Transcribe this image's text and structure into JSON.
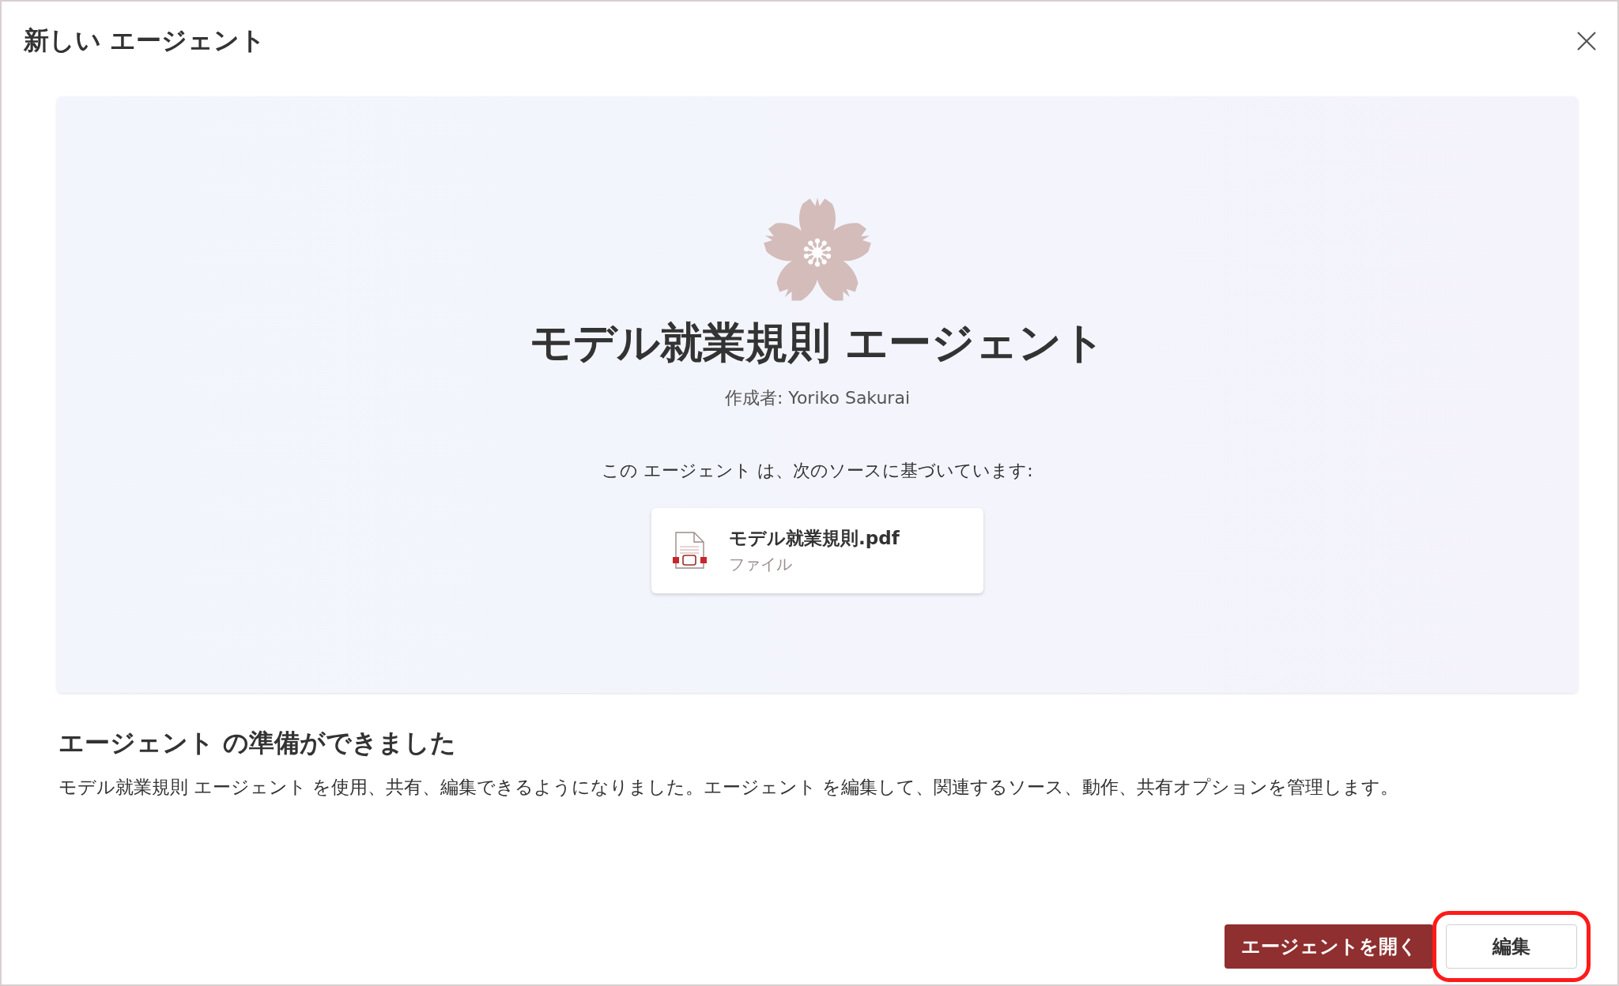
{
  "dialog": {
    "title": "新しい エージェント"
  },
  "agent": {
    "name": "モデル就業規則 エージェント",
    "author": "作成者: Yoriko Sakurai",
    "sources_label": "この エージェント は、次のソースに基づいています:",
    "sources": [
      {
        "name": "モデル就業規則.pdf",
        "type": "ファイル"
      }
    ]
  },
  "ready": {
    "heading": "エージェント の準備ができました",
    "description": "モデル就業規則 エージェント を使用、共有、編集できるようになりました。エージェント を編集して、関連するソース、動作、共有オプションを管理します。"
  },
  "buttons": [
    {
      "label": "エージェントを開く",
      "kind": "primary",
      "highlighted": false
    },
    {
      "label": "編集",
      "kind": "secondary",
      "highlighted": true
    }
  ]
}
